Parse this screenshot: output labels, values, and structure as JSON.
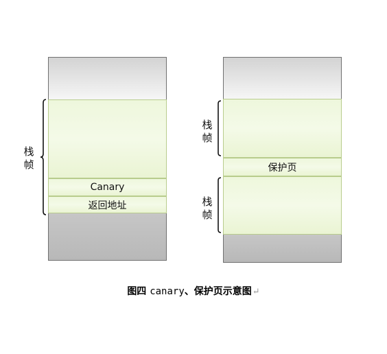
{
  "left_stack": {
    "canary_label": "Canary",
    "return_address_label": "返回地址",
    "frame_label": "栈帧"
  },
  "right_stack": {
    "upper_frame_label": "栈帧",
    "guard_page_label": "保护页",
    "lower_frame_label": "栈帧"
  },
  "caption": {
    "prefix": "图四 ",
    "keyword": "canary",
    "suffix": "、保护页示意图",
    "paragraph_mark": "↵"
  }
}
